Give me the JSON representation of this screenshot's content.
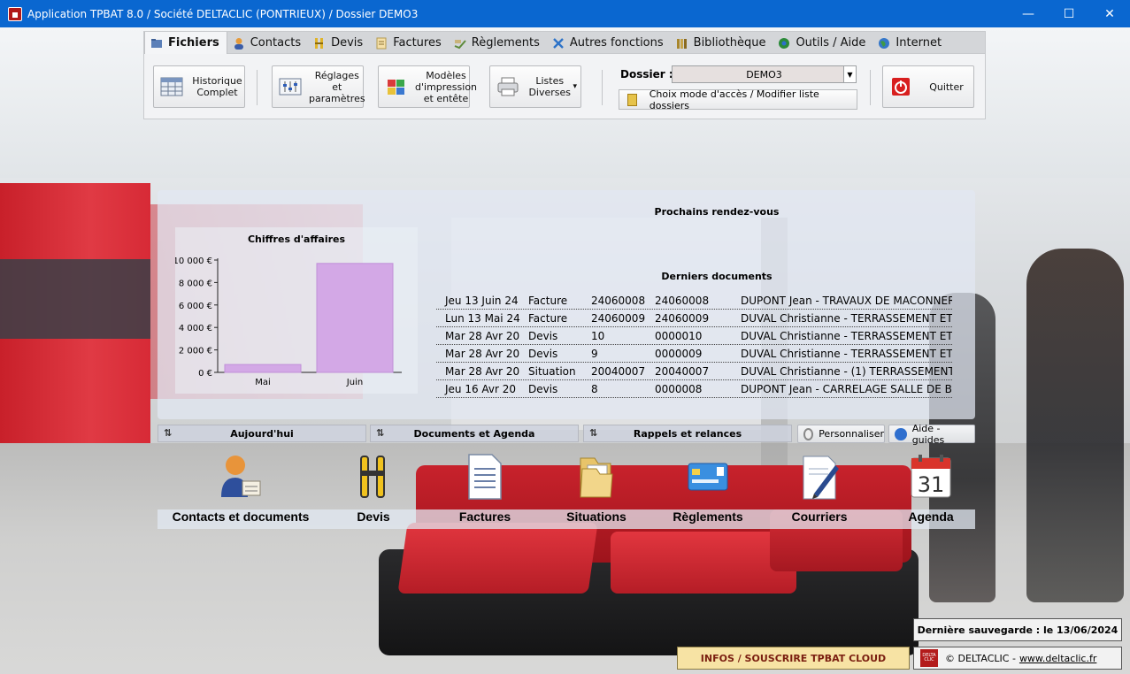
{
  "window": {
    "title": "Application TPBAT 8.0 / Société DELTACLIC (PONTRIEUX) / Dossier DEMO3",
    "minimize": "—",
    "maximize": "☐",
    "close": "✕"
  },
  "ribbon": {
    "tabs": [
      {
        "label": "Fichiers",
        "icon": "folder-icon"
      },
      {
        "label": "Contacts",
        "icon": "contact-icon"
      },
      {
        "label": "Devis",
        "icon": "compass-icon"
      },
      {
        "label": "Factures",
        "icon": "invoice-icon"
      },
      {
        "label": "Règlements",
        "icon": "payment-icon"
      },
      {
        "label": "Autres fonctions",
        "icon": "tools-icon"
      },
      {
        "label": "Bibliothèque",
        "icon": "library-icon"
      },
      {
        "label": "Outils / Aide",
        "icon": "help-tools-icon"
      },
      {
        "label": "Internet",
        "icon": "globe-icon"
      }
    ],
    "buttons": {
      "historique": {
        "line1": "Historique",
        "line2": "Complet"
      },
      "reglages": {
        "line1": "Réglages et",
        "line2": "paramètres"
      },
      "modeles": {
        "line1": "Modèles",
        "line2": "d'impression",
        "line3": "et entête"
      },
      "listes": {
        "line1": "Listes",
        "line2": "Diverses",
        "arrow": "▾"
      },
      "quitter": "Quitter"
    },
    "dossier": {
      "label": "Dossier :",
      "value": "DEMO3",
      "arrow": "▼",
      "choix_label": "Choix mode d'accès / Modifier liste dossiers"
    }
  },
  "dashboard": {
    "rdv_title": "Prochains rendez-vous",
    "docs_title": "Derniers documents",
    "documents": [
      {
        "date": "Jeu 13 Juin 24",
        "type": "Facture",
        "num": "24060008",
        "ref": "24060008",
        "desc": "DUPONT Jean - TRAVAUX DE MACONNER"
      },
      {
        "date": "Lun 13 Mai 24",
        "type": "Facture",
        "num": "24060009",
        "ref": "24060009",
        "desc": "DUVAL Christianne - TERRASSEMENT ET I"
      },
      {
        "date": "Mar 28 Avr 20",
        "type": "Devis",
        "num": "10",
        "ref": "0000010",
        "desc": "DUVAL Christianne - TERRASSEMENT ET I"
      },
      {
        "date": "Mar 28 Avr 20",
        "type": "Devis",
        "num": "9",
        "ref": "0000009",
        "desc": "DUVAL Christianne - TERRASSEMENT ET I"
      },
      {
        "date": "Mar 28 Avr 20",
        "type": "Situation",
        "num": "20040007",
        "ref": "20040007",
        "desc": "DUVAL Christianne - (1) TERRASSEMENT"
      },
      {
        "date": "Jeu 16 Avr 20",
        "type": "Devis",
        "num": "8",
        "ref": "0000008",
        "desc": "DUPONT Jean - CARRELAGE SALLE DE BA"
      }
    ]
  },
  "chart_data": {
    "type": "bar",
    "title": "Chiffres d'affaires",
    "categories": [
      "Mai",
      "Juin"
    ],
    "values": [
      700,
      9700
    ],
    "ylim": [
      0,
      10000
    ],
    "yticks": [
      "0 €",
      "2 000 €",
      "4 000 €",
      "6 000 €",
      "8 000 €",
      "10 000 €"
    ],
    "ytick_values": [
      0,
      2000,
      4000,
      6000,
      8000,
      10000
    ],
    "bar_color": "#d3a8e6",
    "grid": false
  },
  "bottom_tabs": {
    "aujourdhui": "Aujourd'hui",
    "documents_agenda": "Documents et Agenda",
    "rappels": "Rappels et relances",
    "sort_glyph": "⇅",
    "personnaliser": "Personnaliser",
    "aide": "Aide - guides"
  },
  "modules": [
    {
      "label": "Contacts et documents",
      "icon": "contact-card-icon"
    },
    {
      "label": "Devis",
      "icon": "compass-icon"
    },
    {
      "label": "Factures",
      "icon": "document-icon"
    },
    {
      "label": "Situations",
      "icon": "folder-icon"
    },
    {
      "label": "Règlements",
      "icon": "credit-card-icon"
    },
    {
      "label": "Courriers",
      "icon": "letter-pen-icon"
    },
    {
      "label": "Agenda",
      "icon": "calendar-icon",
      "day": "31"
    }
  ],
  "footer": {
    "save_text": "Dernière sauvegarde : le 13/06/2024",
    "cloud_button": "INFOS / SOUSCRIRE TPBAT CLOUD",
    "copyright": "© DELTACLIC - ",
    "link": "www.deltaclic.fr",
    "logo_text": "DELTA CLIC"
  },
  "colors": {
    "titlebar": "#0a67d0",
    "quit_red": "#d81f1f",
    "cloud_bg": "#f7e3a4"
  }
}
